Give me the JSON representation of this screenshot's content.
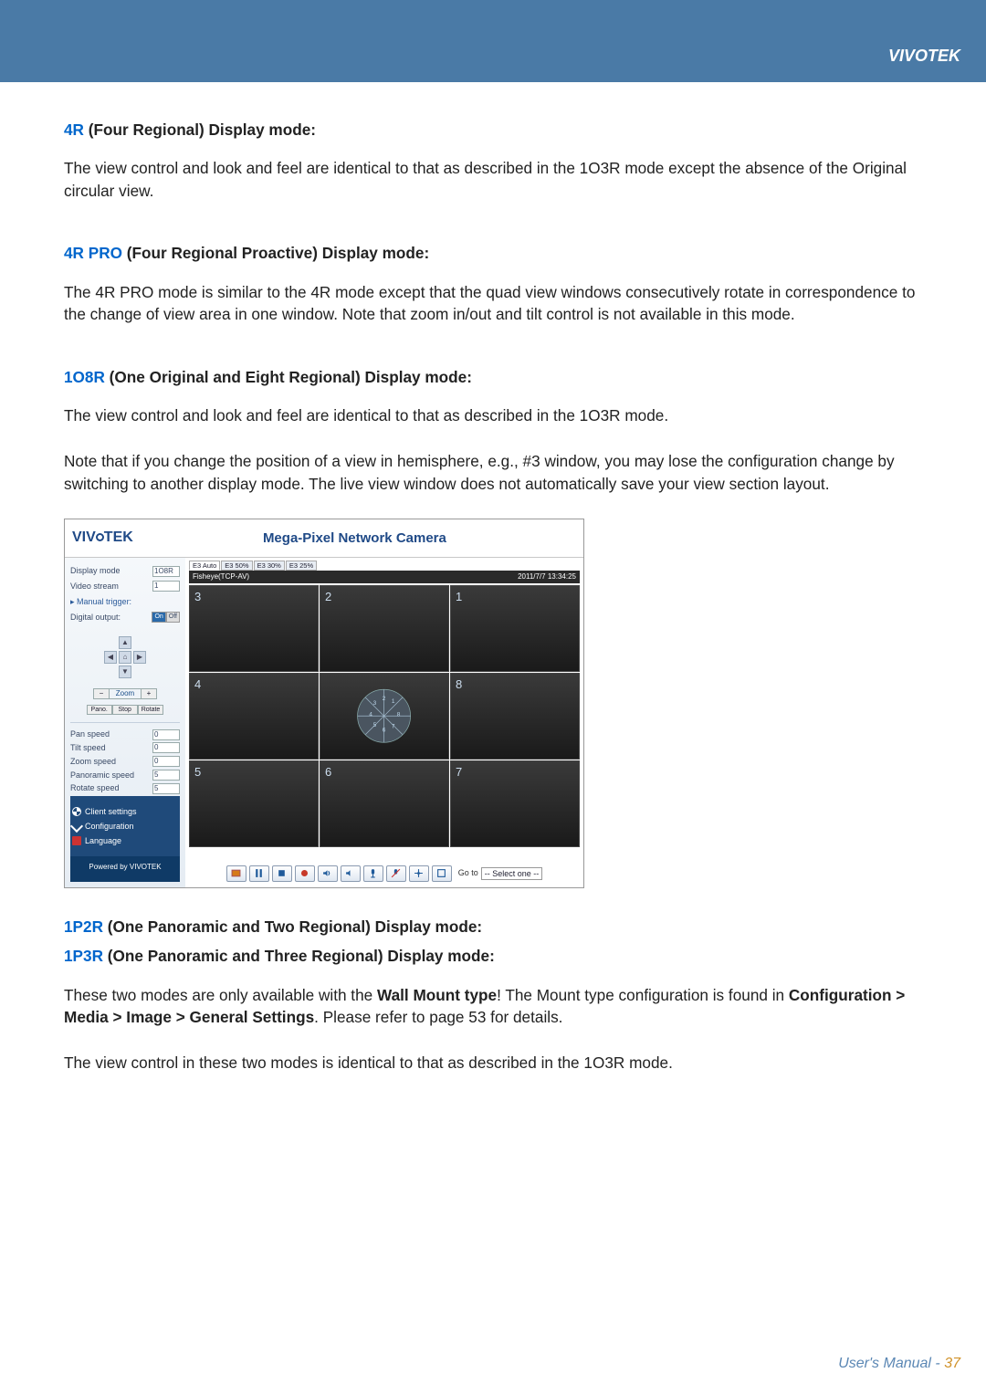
{
  "header": {
    "brand": "VIVOTEK"
  },
  "sections": {
    "s4r": {
      "code": "4R",
      "title_rest": " (Four Regional) Display mode:",
      "p1": "The view control and look and feel are identical to that as described in the 1O3R mode except the absence of the Original circular view."
    },
    "s4rpro": {
      "code": "4R PRO",
      "title_rest": " (Four Regional Proactive) Display mode:",
      "p1": "The 4R PRO mode is similar to the 4R mode except that the quad view windows consecutively rotate in correspondence to the change of view area in one window. Note that zoom in/out and tilt control is not available in this mode."
    },
    "s1o8r": {
      "code": "1O8R",
      "title_rest": " (One Original and Eight Regional) Display mode:",
      "p1": "The view control and look and feel are identical to that as described in the 1O3R mode.",
      "p2": "Note that if you change the position of a view in hemisphere, e.g., #3 window, you may lose the configuration change by switching to another display mode. The live view window does not automatically save your view section layout."
    },
    "s1p": {
      "code1": "1P2R",
      "title_rest1": " (One Panoramic and Two Regional) Display mode:",
      "code2": "1P3R",
      "title_rest2": " (One Panoramic and Three Regional) Display mode:",
      "p1a": "These two modes are only available with the ",
      "p1b_bold": "Wall Mount type",
      "p1c": "! The Mount type configuration is found in ",
      "p1d_bold": "Configuration > Media > Image > General Settings",
      "p1e": ". Please refer to page 53 for details.",
      "p2": "The view control in these two modes is identical to that as described in the 1O3R mode."
    }
  },
  "camera_ui": {
    "logo": "VIV",
    "logo2": "TEK",
    "headline": "Mega-Pixel Network Camera",
    "side": {
      "display_mode_label": "Display mode",
      "display_mode_value": "1O8R",
      "video_stream_label": "Video stream",
      "video_stream_value": "1",
      "manual_trigger": "Manual trigger:",
      "digital_output_label": "Digital output:",
      "digital_output_on": "On",
      "digital_output_off": "Off",
      "zoom_label": "Zoom",
      "zoom_minus": "−",
      "zoom_plus": "+",
      "mode_pano": "Pano.",
      "mode_stop": "Stop",
      "mode_rotate": "Rotate",
      "speeds": {
        "pan": {
          "label": "Pan speed",
          "value": "0"
        },
        "tilt": {
          "label": "Tilt speed",
          "value": "0"
        },
        "zoom": {
          "label": "Zoom speed",
          "value": "0"
        },
        "panor": {
          "label": "Panoramic speed",
          "value": "5"
        },
        "rot": {
          "label": "Rotate speed",
          "value": "5"
        }
      },
      "link_client": "Client settings",
      "link_config": "Configuration",
      "link_lang": "Language",
      "powered": "Powered by VIVOTEK"
    },
    "main": {
      "tabs": [
        "E3 Auto",
        "E3 50%",
        "E3 30%",
        "E3 25%"
      ],
      "info_left": "Fisheye(TCP-AV)",
      "info_right": "2011/7/7 13:34:25",
      "cells": {
        "r1": [
          "3",
          "2",
          "1"
        ],
        "r2": [
          "4",
          "fisheye",
          "8"
        ],
        "r3": [
          "5",
          "6",
          "7"
        ]
      },
      "footer": {
        "goto_label": "Go to",
        "goto_value": "-- Select one --"
      }
    }
  },
  "footer": {
    "label": "User's Manual - ",
    "page": "37"
  }
}
